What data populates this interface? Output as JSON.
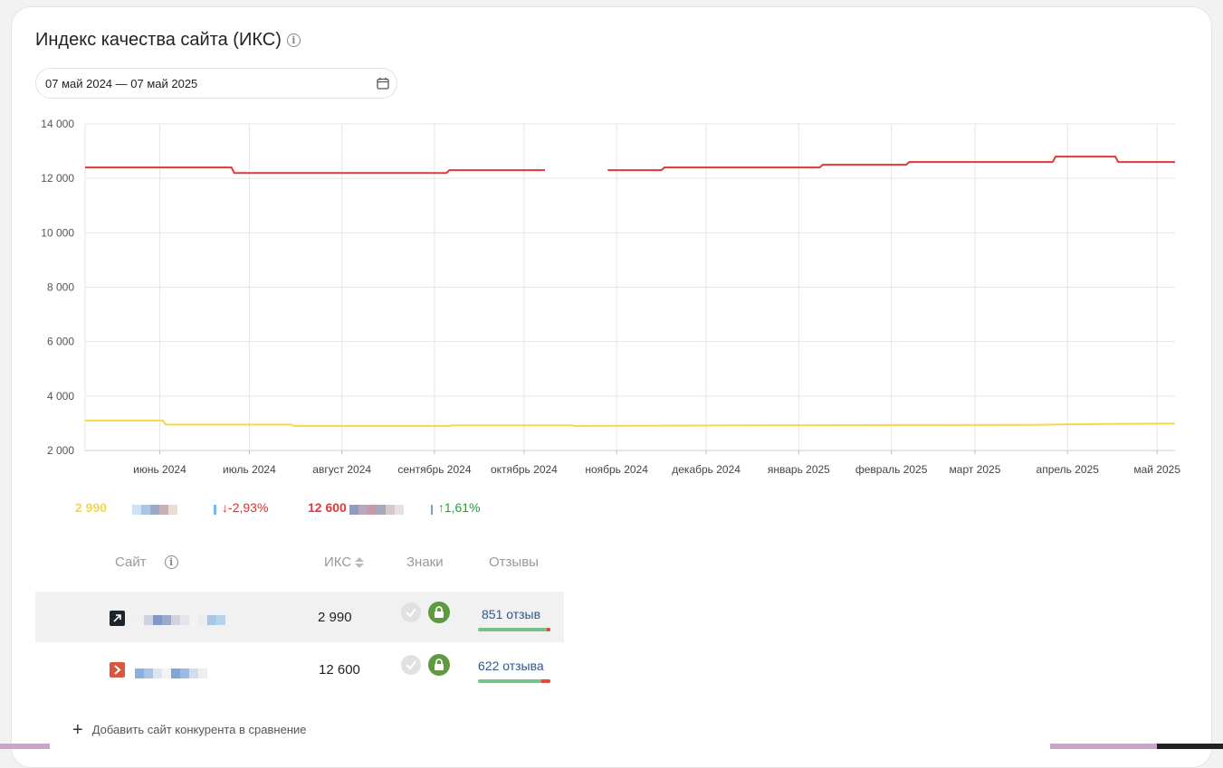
{
  "widget": {
    "title": "Индекс качества сайта (ИКС)",
    "date_range": "07 май 2024 — 07 май 2025"
  },
  "colors": {
    "site1": "#f5d84a",
    "site2": "#e0393a",
    "up": "#2a9a3c",
    "down": "#d9332d",
    "link": "#2a5a8f"
  },
  "chart_data": {
    "type": "line",
    "y_ticks": [
      "14 000",
      "12 000",
      "10 000",
      "8 000",
      "6 000",
      "4 000",
      "2 000"
    ],
    "x_ticks": [
      "июнь 2024",
      "июль 2024",
      "август 2024",
      "сентябрь 2024",
      "октябрь 2024",
      "ноябрь 2024",
      "декабрь 2024",
      "январь 2025",
      "февраль 2025",
      "март 2025",
      "апрель 2025",
      "май 2025"
    ],
    "ylim": [
      2000,
      14000
    ],
    "grid": true,
    "series": [
      {
        "color": "#e0393a",
        "points": [
          [
            "2024-05-07",
            12400
          ],
          [
            "2024-06-25",
            12400
          ],
          [
            "2024-06-26",
            12200
          ],
          [
            "2024-09-05",
            12200
          ],
          [
            "2024-09-06",
            12300
          ],
          [
            "2024-10-08",
            12300
          ],
          null,
          [
            "2024-10-29",
            12300
          ],
          [
            "2024-11-16",
            12300
          ],
          [
            "2024-11-17",
            12400
          ],
          [
            "2025-01-08",
            12400
          ],
          [
            "2025-01-09",
            12500
          ],
          [
            "2025-02-06",
            12500
          ],
          [
            "2025-02-07",
            12600
          ],
          [
            "2025-03-27",
            12600
          ],
          [
            "2025-03-28",
            12800
          ],
          [
            "2025-04-17",
            12800
          ],
          [
            "2025-04-18",
            12600
          ],
          [
            "2025-05-07",
            12600
          ]
        ]
      },
      {
        "color": "#f5d84a",
        "points": [
          [
            "2024-05-07",
            3100
          ],
          [
            "2024-06-02",
            3100
          ],
          [
            "2024-06-03",
            2950
          ],
          [
            "2024-07-15",
            2950
          ],
          [
            "2024-07-16",
            2900
          ],
          [
            "2024-09-06",
            2900
          ],
          [
            "2024-09-07",
            2920
          ],
          [
            "2024-10-17",
            2920
          ],
          [
            "2024-10-18",
            2900
          ],
          [
            "2024-12-10",
            2920
          ],
          [
            "2025-03-21",
            2940
          ],
          [
            "2025-03-31",
            2960
          ],
          [
            "2025-04-20",
            2980
          ],
          [
            "2025-05-07",
            2990
          ]
        ]
      }
    ]
  },
  "legend": {
    "site1": {
      "value": "2 990",
      "change": "↓-2,93%"
    },
    "site2": {
      "value": "12 600",
      "change": "↑1,61%"
    }
  },
  "table": {
    "headers": {
      "site": "Сайт",
      "iks": "ИКС",
      "signs": "Знаки",
      "reviews": "Отзывы"
    },
    "rows": [
      {
        "iks": "2 990",
        "reviews": "851 отзыв",
        "review_share": 0.95
      },
      {
        "iks": "12 600",
        "reviews": "622 отзыва",
        "review_share": 0.88
      }
    ]
  },
  "add_competitor": "Добавить сайт конкурента в сравнение"
}
